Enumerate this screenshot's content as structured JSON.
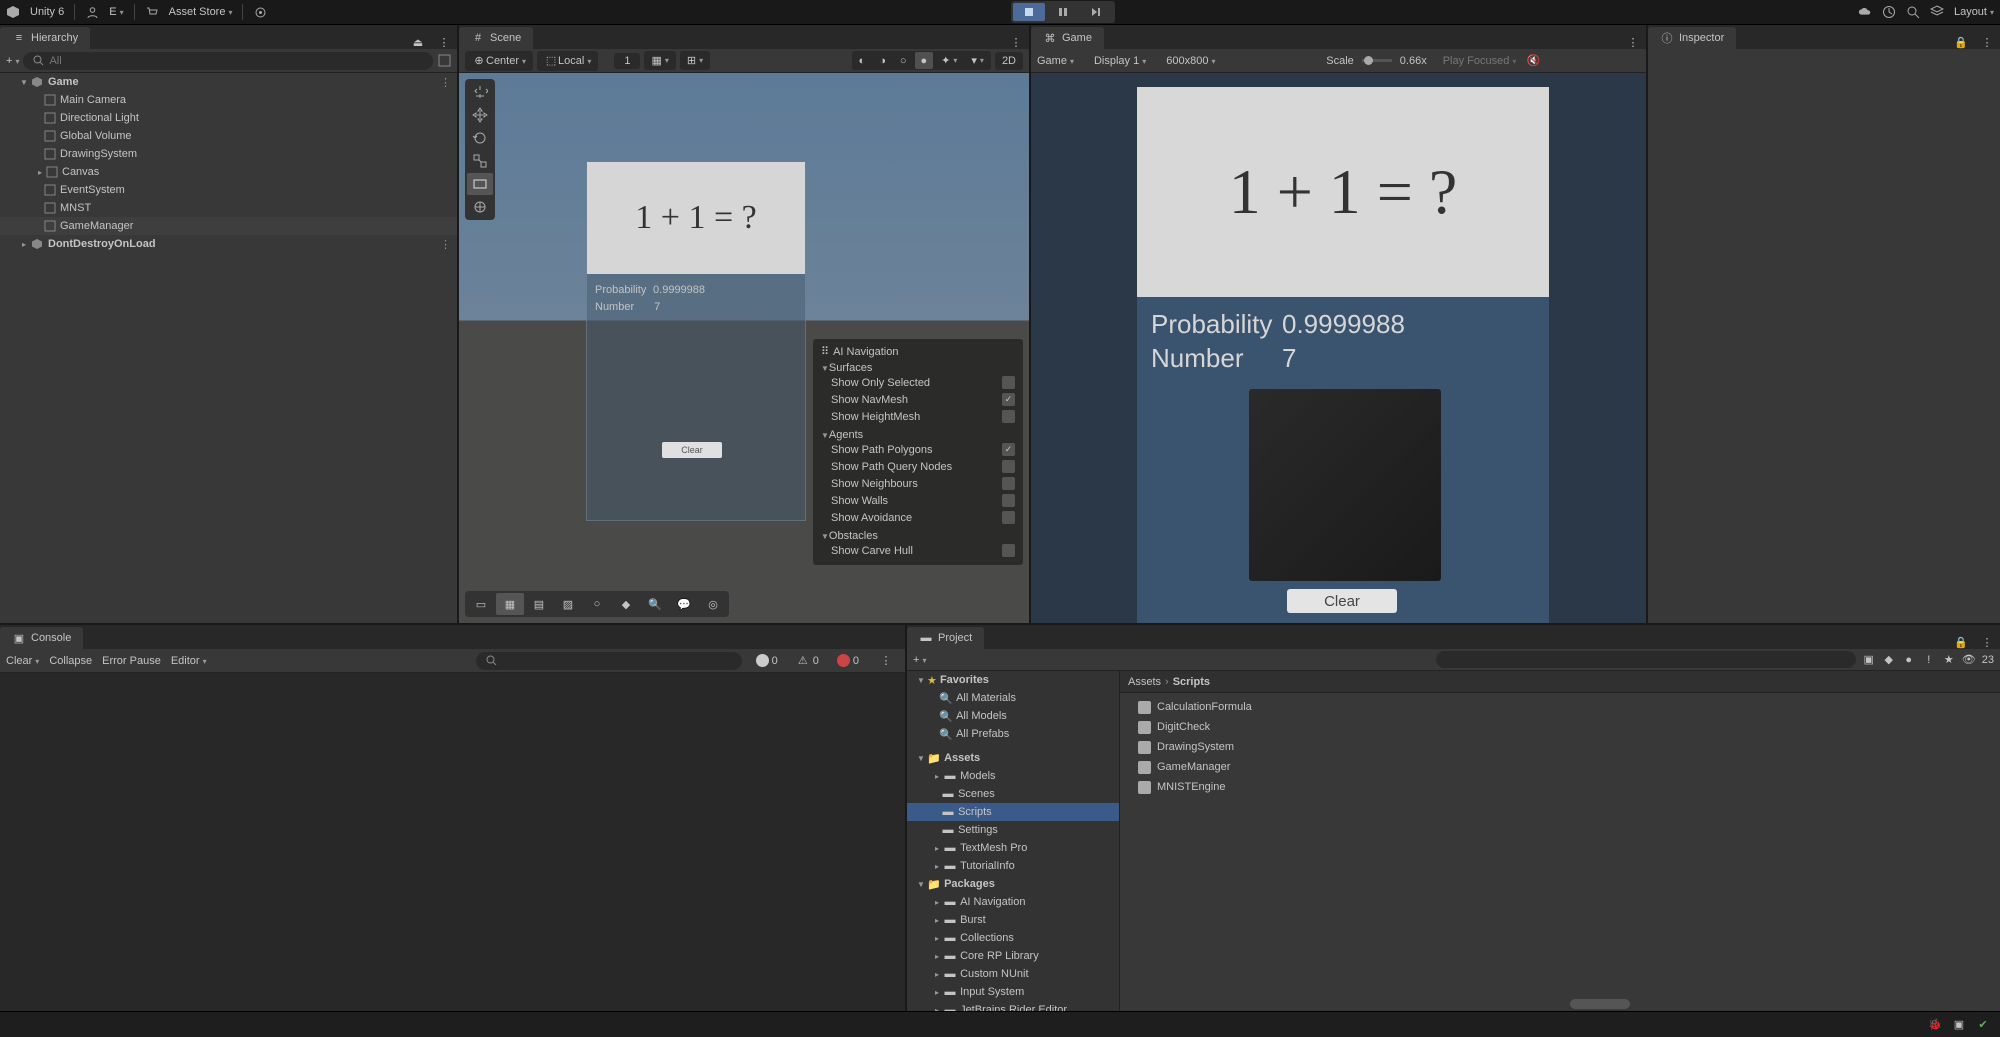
{
  "topbar": {
    "app": "Unity 6",
    "user": "E",
    "assetStore": "Asset Store",
    "layout": "Layout"
  },
  "hierarchy": {
    "title": "Hierarchy",
    "searchPlaceholder": "All",
    "root1": "Game",
    "items": [
      "Main Camera",
      "Directional Light",
      "Global Volume",
      "DrawingSystem",
      "Canvas",
      "EventSystem",
      "MNST",
      "GameManager"
    ],
    "root2": "DontDestroyOnLoad"
  },
  "scene": {
    "title": "Scene",
    "center": "Center",
    "local": "Local",
    "gridVal": "1",
    "mode2d": "2D",
    "equation": "1 + 1 = ?",
    "probLabel": "Probability",
    "probVal": "0.9999988",
    "numLabel": "Number",
    "numVal": "7",
    "clear": "Clear",
    "nav": {
      "title": "AI Navigation",
      "surfaces": "Surfaces",
      "s1": "Show Only Selected",
      "s2": "Show NavMesh",
      "s3": "Show HeightMesh",
      "agents": "Agents",
      "a1": "Show Path Polygons",
      "a2": "Show Path Query Nodes",
      "a3": "Show Neighbours",
      "a4": "Show Walls",
      "a5": "Show Avoidance",
      "obstacles": "Obstacles",
      "o1": "Show Carve Hull"
    }
  },
  "game": {
    "title": "Game",
    "aspect": "Game",
    "display": "Display 1",
    "res": "600x800",
    "scaleLabel": "Scale",
    "scaleVal": "0.66x",
    "playFocused": "Play Focused",
    "equation": "1 + 1 = ?",
    "probLabel": "Probability",
    "probVal": "0.9999988",
    "numLabel": "Number",
    "numVal": "7",
    "clear": "Clear"
  },
  "inspector": {
    "title": "Inspector"
  },
  "console": {
    "title": "Console",
    "clear": "Clear",
    "collapse": "Collapse",
    "errorPause": "Error Pause",
    "editor": "Editor",
    "c0": "0",
    "c1": "0",
    "c2": "0"
  },
  "project": {
    "title": "Project",
    "favorites": "Favorites",
    "fav": [
      "All Materials",
      "All Models",
      "All Prefabs"
    ],
    "assets": "Assets",
    "folders": [
      "Models",
      "Scenes",
      "Scripts",
      "Settings",
      "TextMesh Pro",
      "TutorialInfo"
    ],
    "packages": "Packages",
    "pkgs": [
      "AI Navigation",
      "Burst",
      "Collections",
      "Core RP Library",
      "Custom NUnit",
      "Input System",
      "JetBrains Rider Editor"
    ],
    "breadcrumb1": "Assets",
    "breadcrumb2": "Scripts",
    "files": [
      "CalculationFormula",
      "DigitCheck",
      "DrawingSystem",
      "GameManager",
      "MNISTEngine"
    ],
    "count": "23"
  }
}
